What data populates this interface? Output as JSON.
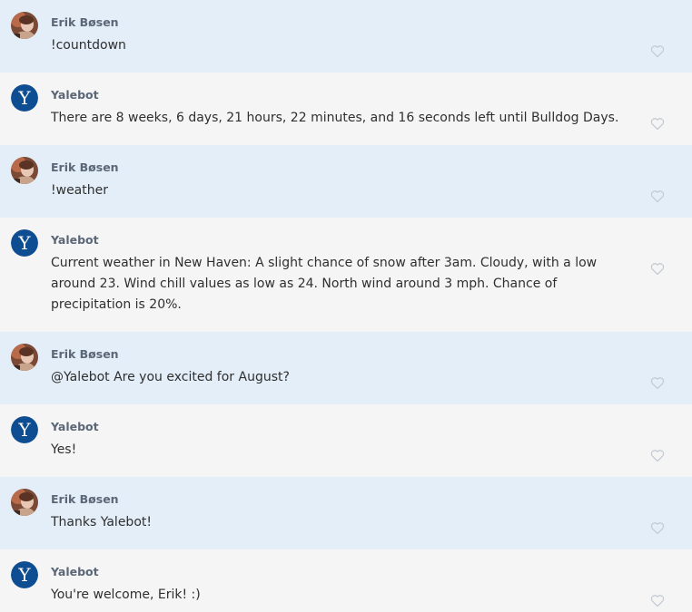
{
  "colors": {
    "user_row_bg": "#e3eef8",
    "bot_row_bg": "#f5f5f5",
    "name_text": "#5b6677",
    "message_text": "#2f2f2f",
    "yale_blue": "#0f4d92"
  },
  "messages": [
    {
      "kind": "user",
      "author": "Erik Bøsen",
      "avatar_icon": "user-photo-avatar",
      "text": "!countdown",
      "action_icon": "heart-icon"
    },
    {
      "kind": "bot",
      "author": "Yalebot",
      "avatar_icon": "yale-y-logo",
      "avatar_letter": "Y",
      "text": "There are 8 weeks, 6 days, 21 hours, 22 minutes, and 16 seconds left until Bulldog Days.",
      "action_icon": "heart-icon"
    },
    {
      "kind": "user",
      "author": "Erik Bøsen",
      "avatar_icon": "user-photo-avatar",
      "text": "!weather",
      "action_icon": "heart-icon"
    },
    {
      "kind": "bot",
      "author": "Yalebot",
      "avatar_icon": "yale-y-logo",
      "avatar_letter": "Y",
      "text": "Current weather in New Haven: A slight chance of snow after 3am. Cloudy, with a low around 23. Wind chill values as low as 24. North wind around 3 mph. Chance of precipitation is 20%.",
      "action_icon": "heart-icon"
    },
    {
      "kind": "user",
      "author": "Erik Bøsen",
      "avatar_icon": "user-photo-avatar",
      "text": "@Yalebot Are you excited for August?",
      "action_icon": "heart-icon"
    },
    {
      "kind": "bot",
      "author": "Yalebot",
      "avatar_icon": "yale-y-logo",
      "avatar_letter": "Y",
      "text": "Yes!",
      "action_icon": "heart-icon"
    },
    {
      "kind": "user",
      "author": "Erik Bøsen",
      "avatar_icon": "user-photo-avatar",
      "text": "Thanks Yalebot!",
      "action_icon": "heart-icon"
    },
    {
      "kind": "bot",
      "author": "Yalebot",
      "avatar_icon": "yale-y-logo",
      "avatar_letter": "Y",
      "text": "You're welcome, Erik! :)",
      "action_icon": "heart-icon"
    }
  ]
}
